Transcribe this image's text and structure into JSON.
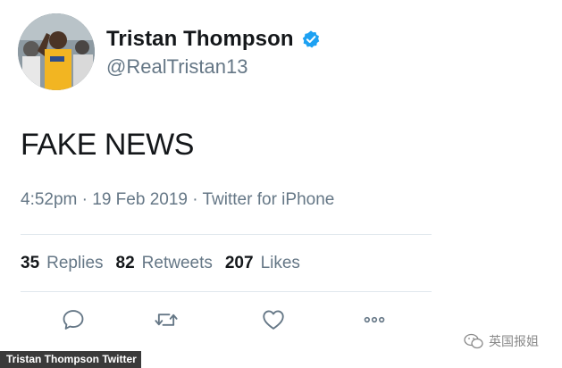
{
  "author": {
    "display_name": "Tristan Thompson",
    "handle": "@RealTristan13",
    "verified": true,
    "avatar_icon": "profile-photo"
  },
  "tweet": {
    "text": "FAKE NEWS",
    "timestamp": "4:52pm · 19 Feb 2019 · Twitter for iPhone"
  },
  "stats": [
    {
      "count": "35",
      "label": "Replies"
    },
    {
      "count": "82",
      "label": "Retweets"
    },
    {
      "count": "207",
      "label": "Likes"
    }
  ],
  "actions": [
    {
      "name": "reply",
      "icon": "reply-icon"
    },
    {
      "name": "retweet",
      "icon": "retweet-icon"
    },
    {
      "name": "like",
      "icon": "heart-icon"
    },
    {
      "name": "more",
      "icon": "more-icon"
    }
  ],
  "photo_credit": "Tristan Thompson Twitter",
  "watermark": "英国报姐",
  "colors": {
    "text_primary": "#14171a",
    "text_secondary": "#657786",
    "verified_blue": "#1da1f2",
    "divider": "#e1e8ed",
    "icon_gray": "#657786"
  }
}
